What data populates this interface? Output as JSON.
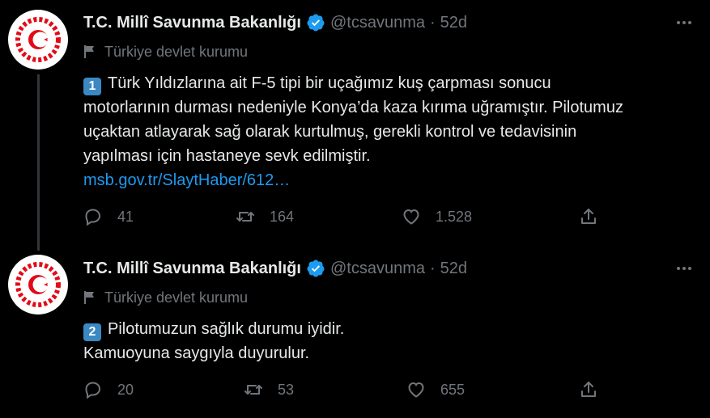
{
  "tweets": [
    {
      "author_name": "T.C. Millî Savunma Bakanlığı",
      "handle": "@tcsavunma",
      "separator": "·",
      "time": "52d",
      "label": "Türkiye devlet kurumu",
      "keycap": "1",
      "lines": [
        "Türk Yıldızlarına ait F-5 tipi bir uçağımız kuş çarpması sonucu",
        "motorlarının durması nedeniyle Konya’da kaza kırıma uğramıştır. Pilotumuz",
        "uçaktan atlayarak sağ olarak kurtulmuş, gerekli kontrol ve tedavisinin",
        "yapılması için hastaneye sevk edilmiştir."
      ],
      "link": "msb.gov.tr/SlaytHaber/612…",
      "replies": "41",
      "retweets": "164",
      "likes": "1.528"
    },
    {
      "author_name": "T.C. Millî Savunma Bakanlığı",
      "handle": "@tcsavunma",
      "separator": "·",
      "time": "52d",
      "label": "Türkiye devlet kurumu",
      "keycap": "2",
      "lines": [
        "Pilotumuzun sağlık durumu iyidir.",
        "Kamuoyuna saygıyla duyurulur."
      ],
      "replies": "20",
      "retweets": "53",
      "likes": "655"
    }
  ],
  "icons": [
    "avatar-emblem",
    "verified-badge-icon",
    "more-icon",
    "flag-icon",
    "reply-icon",
    "retweet-icon",
    "like-icon",
    "share-icon"
  ],
  "colors": {
    "background": "#000000",
    "text": "#e7e9ea",
    "muted": "#71767b",
    "link": "#1d9bf0",
    "verified": "#1d9bf0",
    "emblem": "#e30a17"
  }
}
